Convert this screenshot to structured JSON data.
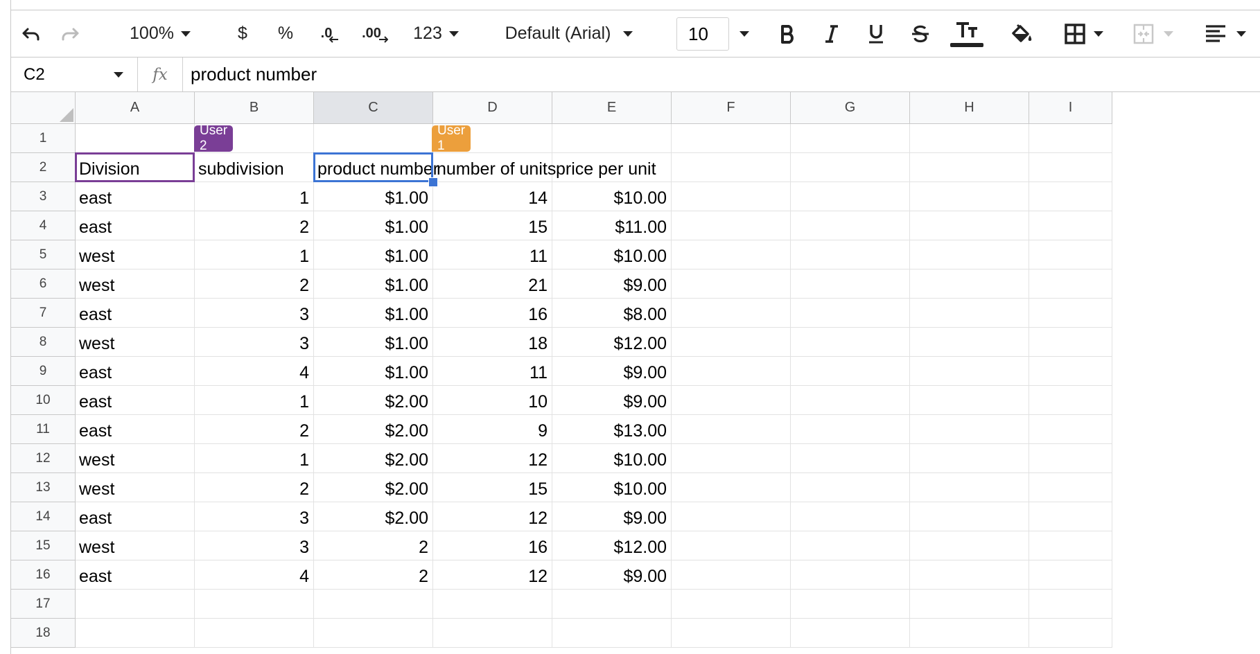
{
  "toolbar": {
    "zoom": "100%",
    "currency": "$",
    "percent": "%",
    "decrease_decimals": ".0",
    "increase_decimals": ".00",
    "number_format": "123",
    "font": "Default (Arial)",
    "font_size": "10"
  },
  "formula_bar": {
    "cell_ref": "C2",
    "fx": "fx",
    "value": "product number"
  },
  "columns": [
    "A",
    "B",
    "C",
    "D",
    "E",
    "F",
    "G",
    "H",
    "I"
  ],
  "rows": [
    "1",
    "2",
    "3",
    "4",
    "5",
    "6",
    "7",
    "8",
    "9",
    "10",
    "11",
    "12",
    "13",
    "14",
    "15",
    "16",
    "17",
    "18"
  ],
  "cells": [
    [
      "",
      "",
      "",
      "",
      ""
    ],
    [
      "Division",
      "subdivision",
      "product number",
      "number of units",
      "price per unit"
    ],
    [
      "east",
      "1",
      "$1.00",
      "14",
      "$10.00"
    ],
    [
      "east",
      "2",
      "$1.00",
      "15",
      "$11.00"
    ],
    [
      "west",
      "1",
      "$1.00",
      "11",
      "$10.00"
    ],
    [
      "west",
      "2",
      "$1.00",
      "21",
      "$9.00"
    ],
    [
      "east",
      "3",
      "$1.00",
      "16",
      "$8.00"
    ],
    [
      "west",
      "3",
      "$1.00",
      "18",
      "$12.00"
    ],
    [
      "east",
      "4",
      "$1.00",
      "11",
      "$9.00"
    ],
    [
      "east",
      "1",
      "$2.00",
      "10",
      "$9.00"
    ],
    [
      "east",
      "2",
      "$2.00",
      "9",
      "$13.00"
    ],
    [
      "west",
      "1",
      "$2.00",
      "12",
      "$10.00"
    ],
    [
      "west",
      "2",
      "$2.00",
      "15",
      "$10.00"
    ],
    [
      "east",
      "3",
      "$2.00",
      "12",
      "$9.00"
    ],
    [
      "west",
      "3",
      "2",
      "16",
      "$12.00"
    ],
    [
      "east",
      "4",
      "2",
      "12",
      "$9.00"
    ],
    [
      "",
      "",
      "",
      "",
      ""
    ],
    [
      "",
      "",
      "",
      "",
      ""
    ]
  ],
  "collaborators": [
    {
      "label": "User 2",
      "color": "#7a3e96",
      "cell": "A2"
    },
    {
      "label": "User 1",
      "color": "#ec9f3c",
      "cell": "C2"
    }
  ],
  "active_cell": "C2",
  "colors": {
    "selection": "#3c74d4"
  }
}
